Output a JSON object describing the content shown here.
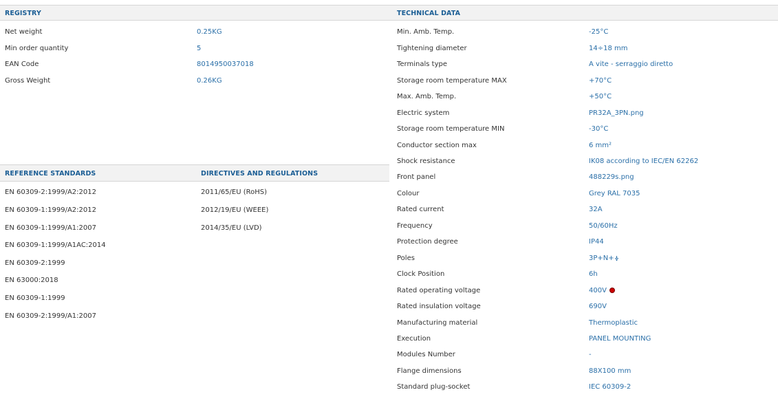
{
  "registry": {
    "title": "REGISTRY",
    "rows": [
      {
        "label": "Net weight",
        "value": "0.25KG"
      },
      {
        "label": "Min order quantity",
        "value": "5"
      },
      {
        "label": "EAN Code",
        "value": "8014950037018"
      },
      {
        "label": "Gross Weight",
        "value": "0.26KG"
      }
    ]
  },
  "reference_standards": {
    "title": "REFERENCE STANDARDS",
    "items": [
      "EN 60309-2:1999/A2:2012",
      "EN 60309-1:1999/A2:2012",
      "EN 60309-1:1999/A1:2007",
      "EN 60309-1:1999/A1AC:2014",
      "EN 60309-2:1999",
      "EN 63000:2018",
      "EN 60309-1:1999",
      "EN 60309-2:1999/A1:2007"
    ]
  },
  "directives": {
    "title": "DIRECTIVES AND REGULATIONS",
    "items": [
      "2011/65/EU (RoHS)",
      "2012/19/EU (WEEE)",
      "2014/35/EU (LVD)"
    ]
  },
  "technical": {
    "title": "TECHNICAL DATA",
    "rows": [
      {
        "label": "Min. Amb. Temp.",
        "value": "-25°C"
      },
      {
        "label": "Tightening diameter",
        "value": "14÷18 mm"
      },
      {
        "label": "Terminals type",
        "value": "A vite - serraggio diretto"
      },
      {
        "label": "Storage room temperature MAX",
        "value": "+70°C"
      },
      {
        "label": "Max. Amb. Temp.",
        "value": "+50°C"
      },
      {
        "label": "Electric system",
        "value": "PR32A_3PN.png"
      },
      {
        "label": "Storage room temperature MIN",
        "value": "-30°C"
      },
      {
        "label": "Conductor section max",
        "value": "6 mm²"
      },
      {
        "label": "Shock resistance",
        "value": "IK08 according to IEC/EN 62262"
      },
      {
        "label": "Front panel",
        "value": "488229s.png"
      },
      {
        "label": "Colour",
        "value": "Grey RAL 7035"
      },
      {
        "label": "Rated current",
        "value": "32A"
      },
      {
        "label": "Frequency",
        "value": "50/60Hz"
      },
      {
        "label": "Protection degree",
        "value": "IP44"
      },
      {
        "label": "Poles",
        "value": "3P+N+"
      },
      {
        "label": "Clock Position",
        "value": "6h"
      },
      {
        "label": "Rated operating voltage",
        "value": "400V"
      },
      {
        "label": "Rated insulation voltage",
        "value": "690V"
      },
      {
        "label": "Manufacturing material",
        "value": "Thermoplastic"
      },
      {
        "label": "Execution",
        "value": "PANEL MOUNTING"
      },
      {
        "label": "Modules Number",
        "value": "-"
      },
      {
        "label": "Flange dimensions",
        "value": "88X100 mm"
      },
      {
        "label": "Standard plug-socket",
        "value": "IEC 60309-2"
      }
    ]
  },
  "icons": {
    "ground": "earth-ground-icon",
    "voltage_marker": "red-dot-icon"
  },
  "colors": {
    "accent": "#1b5e95",
    "value_text": "#2a6fa8",
    "header_bg": "#f2f2f2",
    "voltage_dot": "#cc0000"
  }
}
